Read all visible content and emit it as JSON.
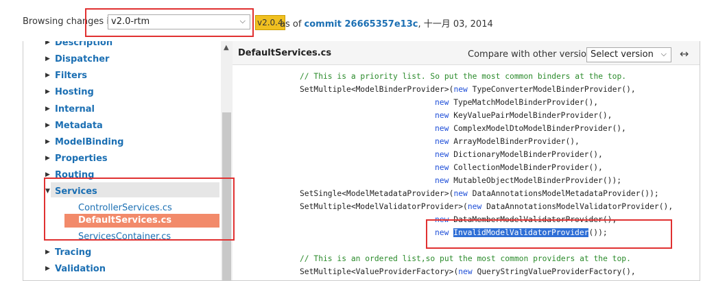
{
  "topbar": {
    "browse_label": "Browsing changes in",
    "branch_value": "v2.0-rtm",
    "tag_badge": "v2.0.4",
    "as_of_text": "as of",
    "commit_text": "commit 26665357e13c",
    "date_text": ", 十一月 03, 2014"
  },
  "sidebar": {
    "items": [
      {
        "label": "Description"
      },
      {
        "label": "Dispatcher"
      },
      {
        "label": "Filters"
      },
      {
        "label": "Hosting"
      },
      {
        "label": "Internal"
      },
      {
        "label": "Metadata"
      },
      {
        "label": "ModelBinding"
      },
      {
        "label": "Properties"
      },
      {
        "label": "Routing"
      },
      {
        "label": "Services"
      },
      {
        "label": "Tracing"
      },
      {
        "label": "Validation"
      }
    ],
    "services_children": [
      {
        "label": "ControllerServices.cs"
      },
      {
        "label": "DefaultServices.cs"
      },
      {
        "label": "ServicesContainer.cs"
      }
    ]
  },
  "panel": {
    "file_title": "DefaultServices.cs",
    "compare_label": "Compare with other versions:",
    "version_select": "Select version"
  },
  "code": {
    "l1": "// This is a priority list. So put the most common binders at the top.",
    "l2a": "SetMultiple<ModelBinderProvider>(",
    "l2b": "new",
    "l2c": " TypeConverterModelBinderProvider(),",
    "l3": " TypeMatchModelBinderProvider(),",
    "l4": " KeyValuePairModelBinderProvider(),",
    "l5": " ComplexModelDtoModelBinderProvider(),",
    "l6": " ArrayModelBinderProvider(),",
    "l7": " DictionaryModelBinderProvider(),",
    "l8": " CollectionModelBinderProvider(),",
    "l9": " MutableObjectModelBinderProvider());",
    "l10a": "SetSingle<ModelMetadataProvider>(",
    "l10c": " DataAnnotationsModelMetadataProvider());",
    "l11a": "SetMultiple<ModelValidatorProvider>(",
    "l11c": " DataAnnotationsModelValidatorProvider(),",
    "l12": " DataMemberModelValidatorProvider(),",
    "l13_hl": "InvalidModelValidatorProvider",
    "l13_end": "());",
    "l14": "// This is an ordered list,so put the most common providers at the top.",
    "l15a": "SetMultiple<ValueProviderFactory>(",
    "l15c": " QueryStringValueProviderFactory(),",
    "kw_new": "new"
  },
  "colors": {
    "link": "#1b6fb3",
    "highlight": "#f28a6a",
    "annotation": "#e03030"
  }
}
